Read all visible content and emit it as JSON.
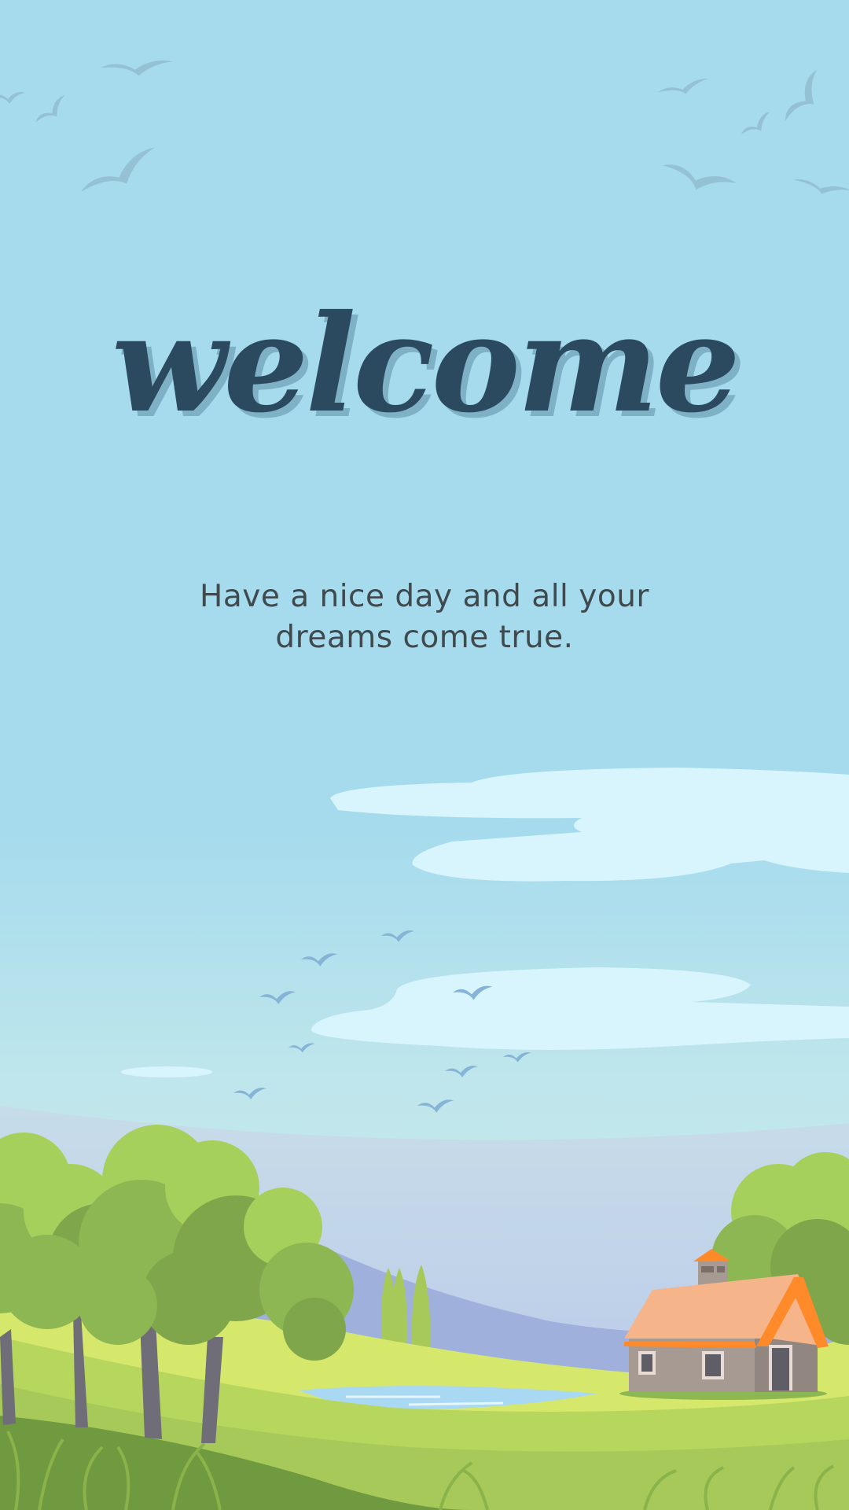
{
  "title": "welcome",
  "message": {
    "line1": "Have a nice day and all your",
    "line2": "dreams come true."
  },
  "colors": {
    "sky_top": "#a6dbed",
    "sky_bottom": "#c8ece6",
    "title": "#2b4a5f",
    "title_shadow": "#7fb1c6",
    "text": "#3f4a4f",
    "cloud": "#d8f4fc",
    "hill_far": "#9fb0dd",
    "grass_light": "#d6e86c",
    "grass_mid": "#a6c95a",
    "grass_dark": "#6f9a3f",
    "tree_light": "#a6d05c",
    "tree_dark": "#7fa64a",
    "roof": "#f5b48a",
    "roof_edge": "#ff8a2a",
    "house_wall": "#a79a92",
    "water": "#a9d8f2"
  },
  "icons": [
    "bird-icon",
    "cloud-icon",
    "tree-icon",
    "house-icon"
  ]
}
